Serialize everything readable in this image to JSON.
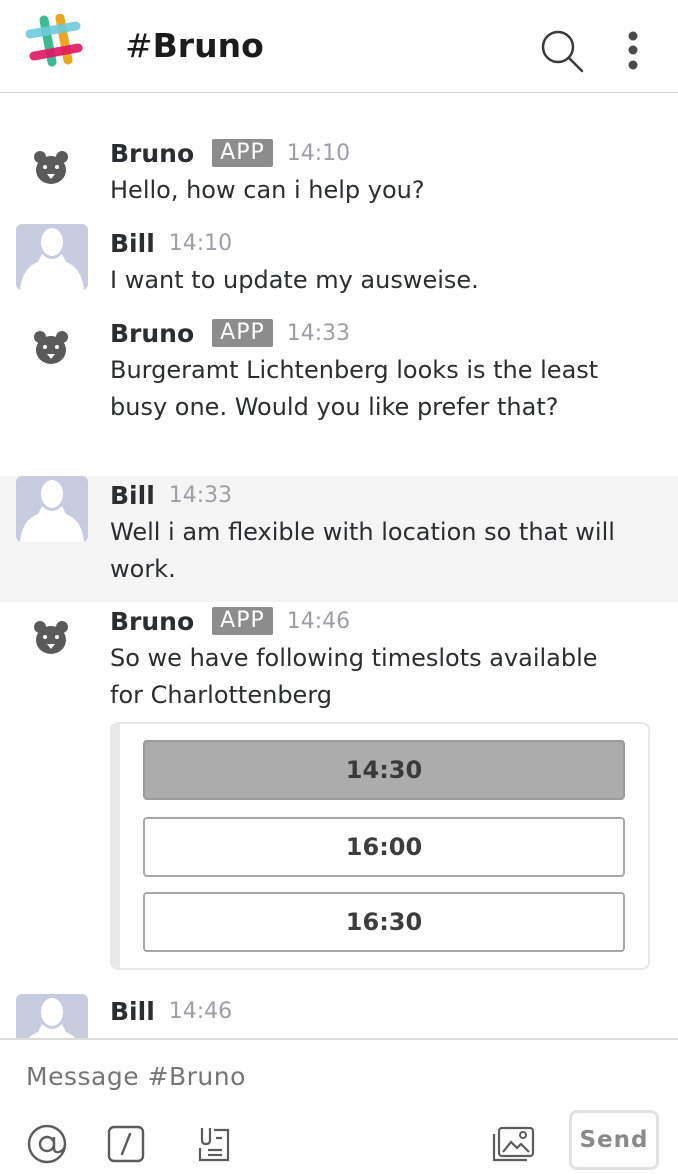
{
  "header": {
    "channel_hash": "#",
    "channel_name": "Bruno",
    "icons": [
      "slack-logo",
      "search-icon",
      "more-vertical-icon"
    ]
  },
  "messages": [
    {
      "author": "Bruno",
      "badge": "APP",
      "time": "14:10",
      "text": "Hello, how can i help you?"
    },
    {
      "author": "Bill",
      "time": "14:10",
      "text": "I want to update my ausweise."
    },
    {
      "author": "Bruno",
      "badge": "APP",
      "time": "14:33",
      "text": "Burgeramt Lichtenberg looks is the least busy one. Would you like prefer that?"
    },
    {
      "author": "Bill",
      "time": "14:33",
      "text": "Well i am flexible with location so that will work."
    },
    {
      "author": "Bruno",
      "badge": "APP",
      "time": "14:46",
      "text": "So we have following timeslots available for Charlottenberg"
    },
    {
      "author": "Bill",
      "time": "14:46",
      "text": ""
    }
  ],
  "timeslots": {
    "options": [
      "14:30",
      "16:00",
      "16:30"
    ],
    "selected": "14:30"
  },
  "composer": {
    "placeholder": "Message #Bruno",
    "send_label": "Send",
    "tool_icons": [
      "at-mention-icon",
      "slash-command-icon",
      "snippet-icon",
      "image-upload-icon"
    ]
  },
  "colors": {
    "badge_bg": "#8d8d8d",
    "avatar_bg": "#c7cddf",
    "bot_icon": "#5a5a5a",
    "selected_slot": "#acacac",
    "logo_teal": "#6ecadc",
    "logo_yellow": "#e9a820",
    "logo_green": "#3eb991",
    "logo_pink": "#e01563"
  }
}
